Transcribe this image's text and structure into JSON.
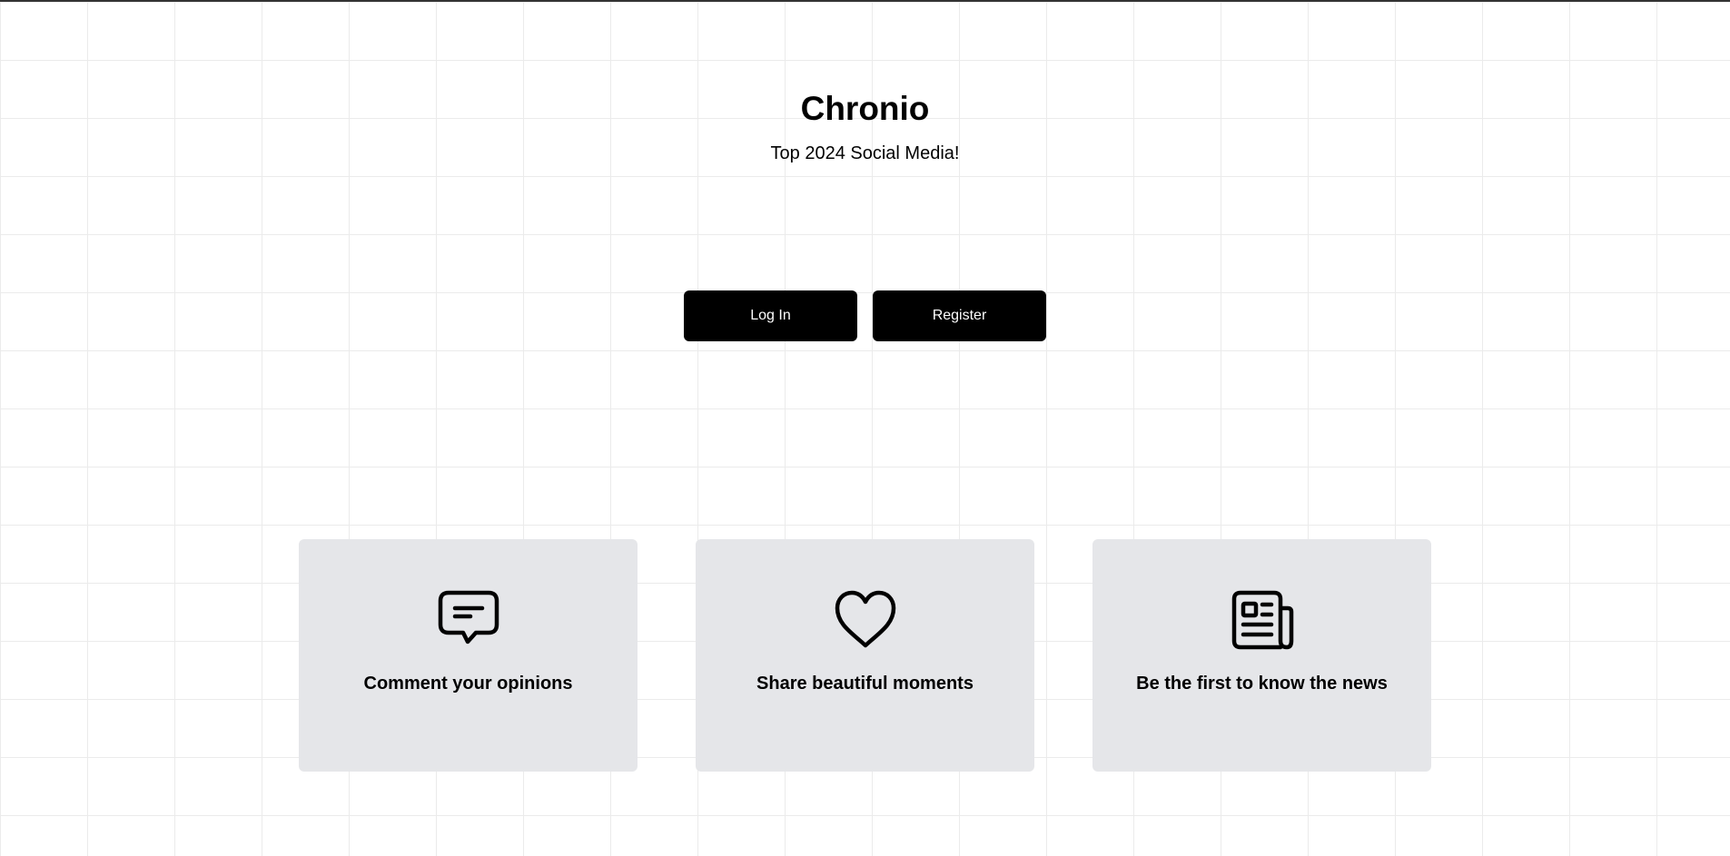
{
  "header": {
    "title": "Chronio",
    "subtitle": "Top 2024 Social Media!"
  },
  "actions": {
    "login_label": "Log In",
    "register_label": "Register"
  },
  "features": [
    {
      "icon": "chat-bubble-icon",
      "label": "Comment your opinions"
    },
    {
      "icon": "heart-icon",
      "label": "Share beautiful moments"
    },
    {
      "icon": "newspaper-icon",
      "label": "Be the first to know the news"
    }
  ],
  "colors": {
    "button_bg": "#000000",
    "button_text": "#ffffff",
    "card_bg": "#e5e6e9",
    "grid_line": "#ebebeb"
  }
}
